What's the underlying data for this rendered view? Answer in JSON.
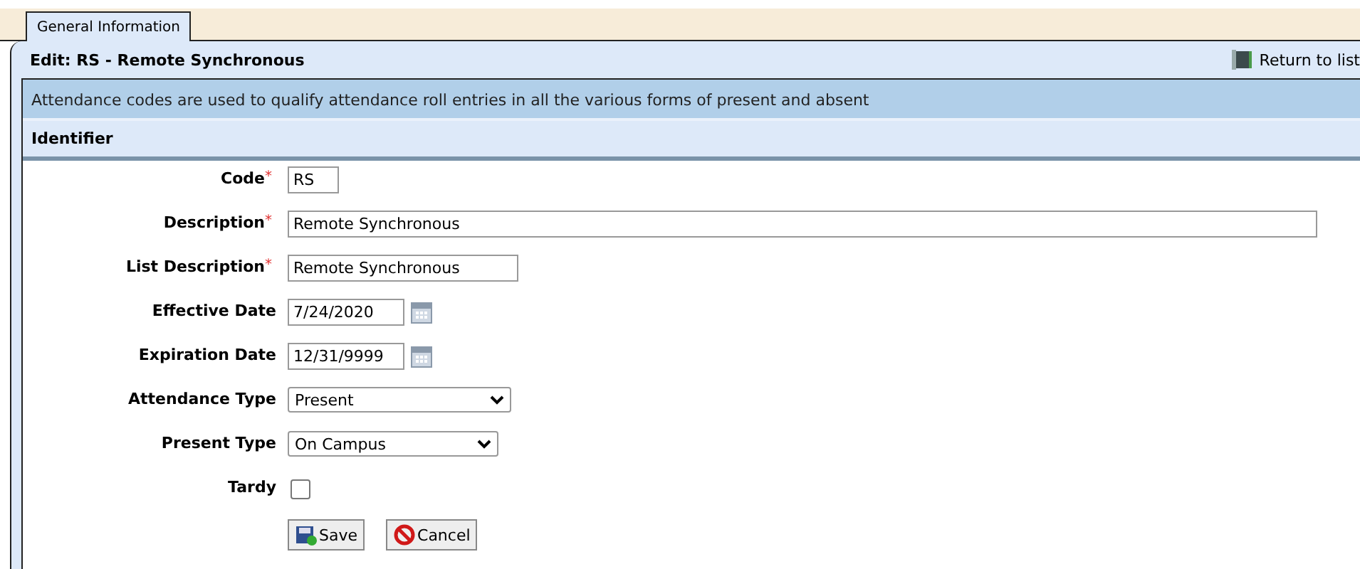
{
  "tabs": [
    {
      "label": "General Information",
      "selected": true
    }
  ],
  "header": {
    "title": "Edit: RS - Remote Synchronous",
    "return_link": "Return to list"
  },
  "info": "Attendance codes are used to qualify attendance roll entries in all the various forms of present and absent",
  "section": "Identifier",
  "fields": [
    {
      "kind": "text",
      "label": "Code",
      "required_mark": "*",
      "value": "RS"
    },
    {
      "kind": "text",
      "label": "Description",
      "required_mark": "*",
      "value": "Remote Synchronous"
    },
    {
      "kind": "text",
      "label": "List Description",
      "required_mark": "*",
      "value": "Remote Synchronous"
    },
    {
      "kind": "date",
      "label": "Effective Date",
      "value": "7/24/2020"
    },
    {
      "kind": "date",
      "label": "Expiration Date",
      "value": "12/31/9999"
    },
    {
      "kind": "select",
      "label": "Attendance Type",
      "value": "Present"
    },
    {
      "kind": "select",
      "label": "Present Type",
      "value": "On Campus"
    },
    {
      "kind": "checkbox",
      "label": "Tardy",
      "checked": false
    }
  ],
  "buttons": [
    {
      "kind": "save",
      "label": "Save"
    },
    {
      "kind": "cancel",
      "label": "Cancel"
    }
  ]
}
